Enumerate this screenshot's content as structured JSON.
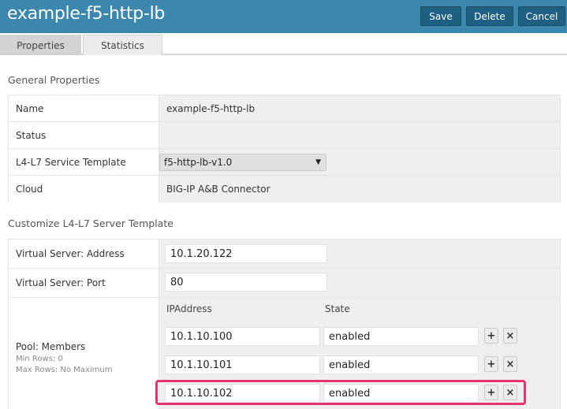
{
  "header": {
    "title": "example-f5-http-lb",
    "save_label": "Save",
    "delete_label": "Delete",
    "cancel_label": "Cancel"
  },
  "tabs": [
    {
      "label": "Properties",
      "active": true
    },
    {
      "label": "Statistics",
      "active": false
    }
  ],
  "general": {
    "section_title": "General Properties",
    "rows": [
      {
        "label": "Name",
        "value": "example-f5-http-lb"
      },
      {
        "label": "Status",
        "value": ""
      },
      {
        "label": "L4-L7 Service Template",
        "value": "f5-http-lb-v1.0"
      },
      {
        "label": "Cloud",
        "value": "BIG-IP A&B Connector"
      }
    ]
  },
  "custom": {
    "section_title": "Customize L4-L7 Server Template",
    "vs_address_label": "Virtual Server: Address",
    "vs_address_value": "10.1.20.122",
    "vs_port_label": "Virtual Server: Port",
    "vs_port_value": "80",
    "pool": {
      "label": "Pool: Members",
      "min_rows": "Min Rows: 0",
      "max_rows": "Max Rows: No Maximum",
      "col_ip": "IPAddress",
      "col_state": "State",
      "members": [
        {
          "ip": "10.1.10.100",
          "state": "enabled"
        },
        {
          "ip": "10.1.10.101",
          "state": "enabled"
        },
        {
          "ip": "10.1.10.102",
          "state": "enabled"
        }
      ],
      "add_symbol": "+",
      "remove_symbol": "×"
    }
  },
  "colors": {
    "header_bg": "#3c87ad",
    "button_bg": "#1f5f82",
    "highlight": "#e8336f"
  }
}
